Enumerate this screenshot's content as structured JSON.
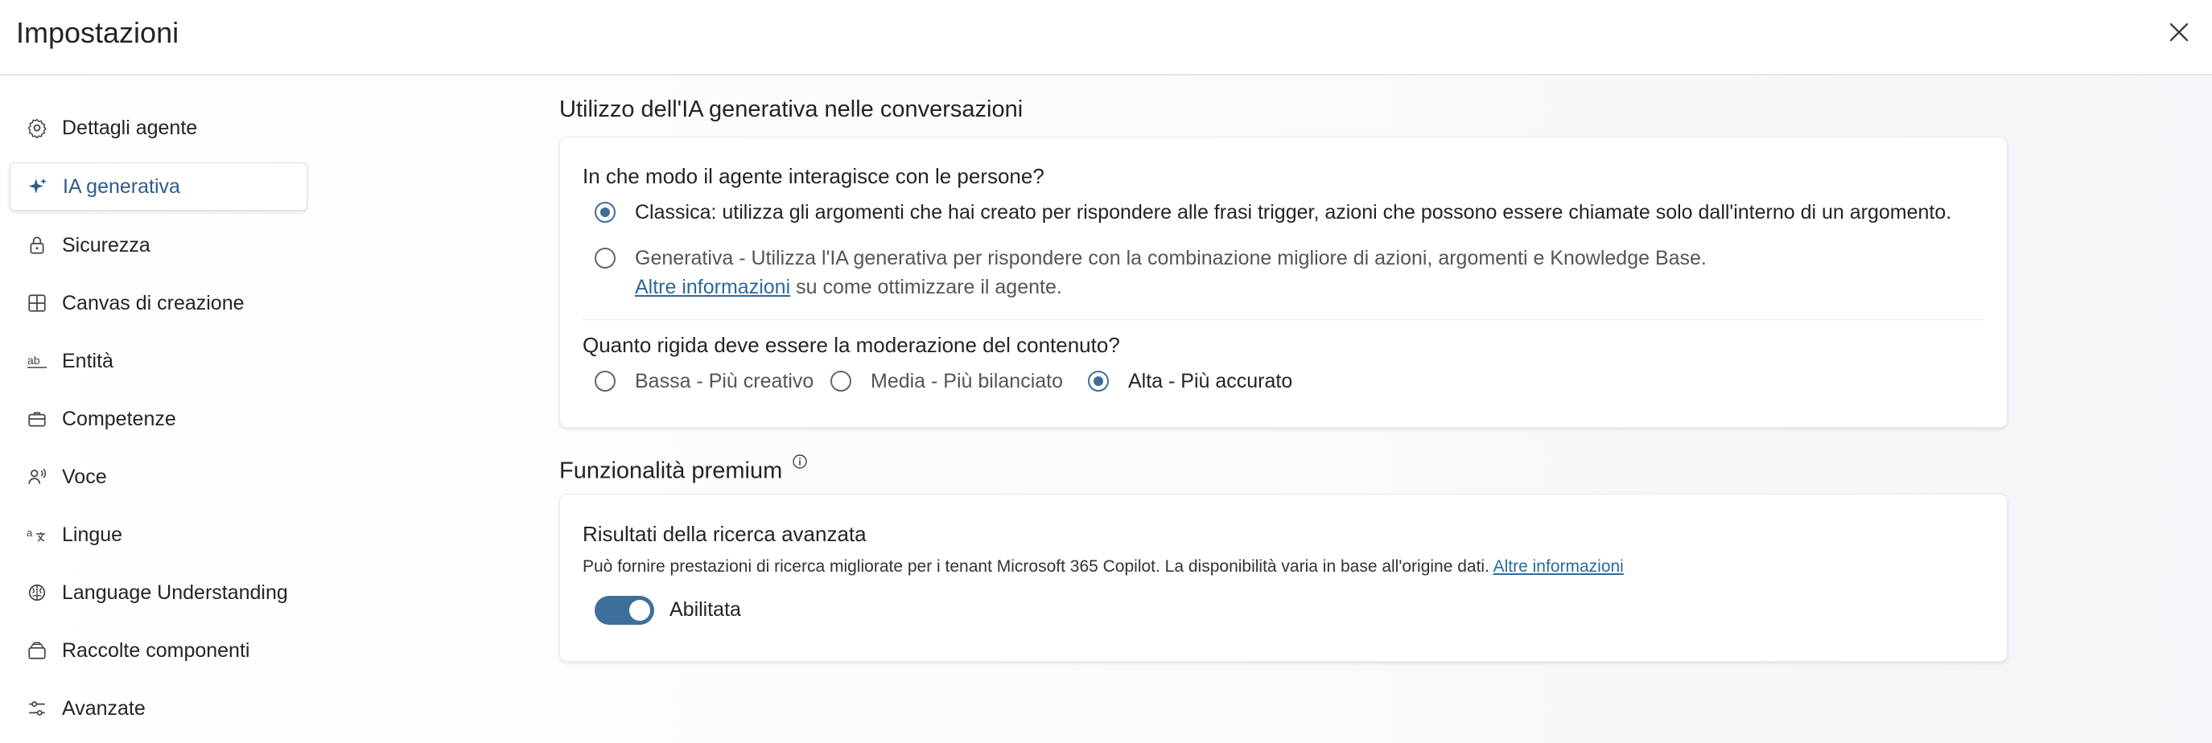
{
  "header": {
    "title": "Impostazioni",
    "close_icon": "close-icon"
  },
  "sidebar": {
    "items": [
      {
        "label": "Dettagli agente",
        "icon": "gear-icon"
      },
      {
        "label": "IA generativa",
        "icon": "sparkle-icon",
        "active": true
      },
      {
        "label": "Sicurezza",
        "icon": "lock-icon"
      },
      {
        "label": "Canvas di creazione",
        "icon": "grid-icon"
      },
      {
        "label": "Entità",
        "icon": "ab-text-icon"
      },
      {
        "label": "Competenze",
        "icon": "briefcase-icon"
      },
      {
        "label": "Voce",
        "icon": "voice-icon"
      },
      {
        "label": "Lingue",
        "icon": "translate-icon"
      },
      {
        "label": "Language Understanding",
        "icon": "brain-icon"
      },
      {
        "label": "Raccolte componenti",
        "icon": "collection-icon"
      },
      {
        "label": "Avanzate",
        "icon": "sliders-icon"
      }
    ]
  },
  "generative": {
    "section_title": "Utilizzo dell'IA generativa nelle conversazioni",
    "interaction_question": "In che modo il agente interagisce con le persone?",
    "classic_option": "Classica: utilizza gli argomenti che hai creato per rispondere alle frasi trigger, azioni che possono essere chiamate solo dall'interno di un argomento.",
    "generative_option": "Generativa - Utilizza l'IA generativa per rispondere con la combinazione migliore di azioni, argomenti e Knowledge Base.",
    "more_info_link": "Altre informazioni",
    "more_info_suffix": "su come ottimizzare il agente.",
    "selected_mode": "classic",
    "moderation_question": "Quanto rigida deve essere la moderazione del contenuto?",
    "moderation_options": [
      {
        "label": "Bassa - Più creativo",
        "selected": false
      },
      {
        "label": "Media - Più bilanciato",
        "selected": false
      },
      {
        "label": "Alta - Più accurato",
        "selected": true
      }
    ]
  },
  "premium": {
    "section_title": "Funzionalità premium",
    "info_icon": "info-icon",
    "card_title": "Risultati della ricerca avanzata",
    "description": "Può fornire prestazioni di ricerca migliorate per i tenant Microsoft 365 Copilot. La disponibilità varia in base all'origine dati.",
    "link": "Altre informazioni",
    "toggle_label": "Abilitata",
    "toggle_on": true
  },
  "colors": {
    "accent": "#3e6f9a",
    "link": "#2c6a9e",
    "active_nav_text": "#2c5d8a"
  }
}
